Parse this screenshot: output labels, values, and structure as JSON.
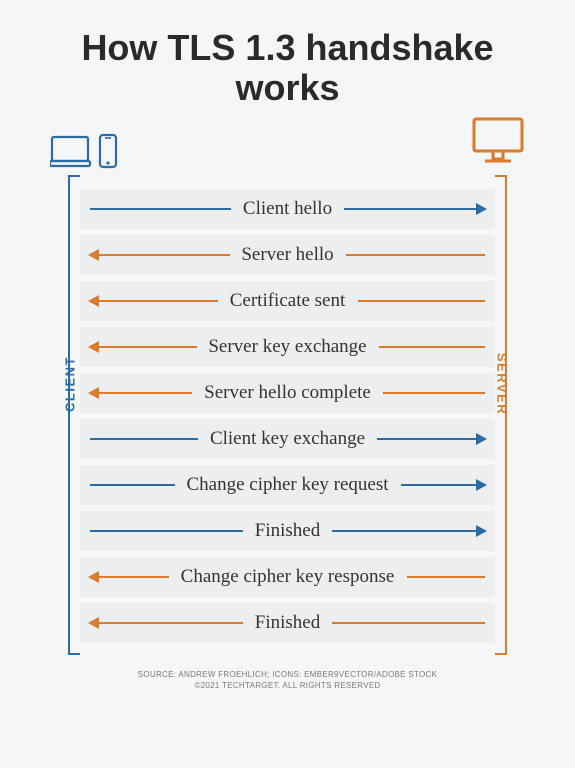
{
  "title": "How TLS 1.3 handshake works",
  "labels": {
    "client": "CLIENT",
    "server": "SERVER"
  },
  "colors": {
    "client": "#2b6ca3",
    "server": "#d97b2a"
  },
  "steps": [
    {
      "label": "Client hello",
      "direction": "to-server"
    },
    {
      "label": "Server hello",
      "direction": "to-client"
    },
    {
      "label": "Certificate sent",
      "direction": "to-client"
    },
    {
      "label": "Server key exchange",
      "direction": "to-client"
    },
    {
      "label": "Server hello complete",
      "direction": "to-client"
    },
    {
      "label": "Client key exchange",
      "direction": "to-server"
    },
    {
      "label": "Change cipher key request",
      "direction": "to-server"
    },
    {
      "label": "Finished",
      "direction": "to-server"
    },
    {
      "label": "Change cipher key response",
      "direction": "to-client"
    },
    {
      "label": "Finished",
      "direction": "to-client"
    }
  ],
  "credits": {
    "line1": "SOURCE: ANDREW FROEHLICH; ICONS: EMBER9VECTOR/ADOBE STOCK",
    "line2": "©2021 TECHTARGET. ALL RIGHTS RESERVED"
  }
}
